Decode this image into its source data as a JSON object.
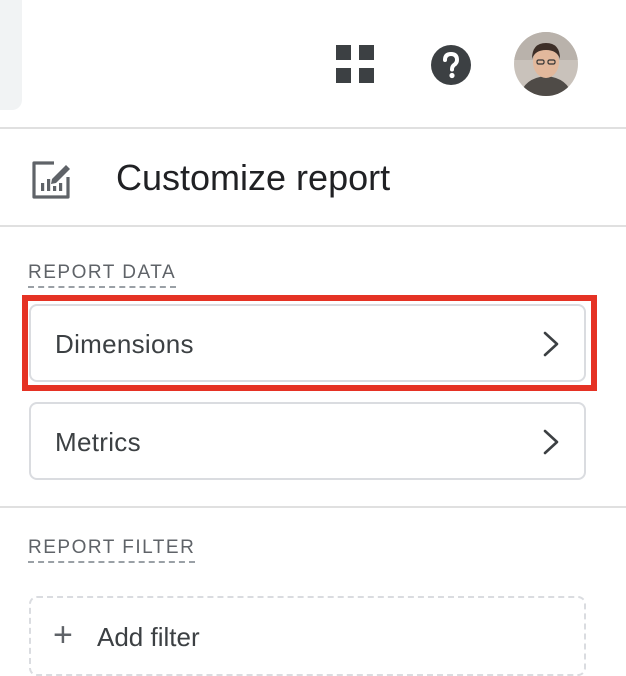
{
  "header": {
    "apps_icon": "apps-grid-icon",
    "help_icon": "help-circle-icon",
    "avatar_icon": "user-avatar"
  },
  "panel": {
    "title": "Customize report",
    "icon": "customize-report-icon"
  },
  "report_data": {
    "label": "REPORT DATA",
    "items": [
      {
        "label": "Dimensions",
        "icon": "chevron-right-icon",
        "highlighted": true
      },
      {
        "label": "Metrics",
        "icon": "chevron-right-icon",
        "highlighted": false
      }
    ]
  },
  "report_filter": {
    "label": "REPORT FILTER",
    "add_filter_label": "Add filter"
  },
  "colors": {
    "highlight": "#e53224",
    "border": "#dadce0",
    "text": "#3c4043"
  }
}
